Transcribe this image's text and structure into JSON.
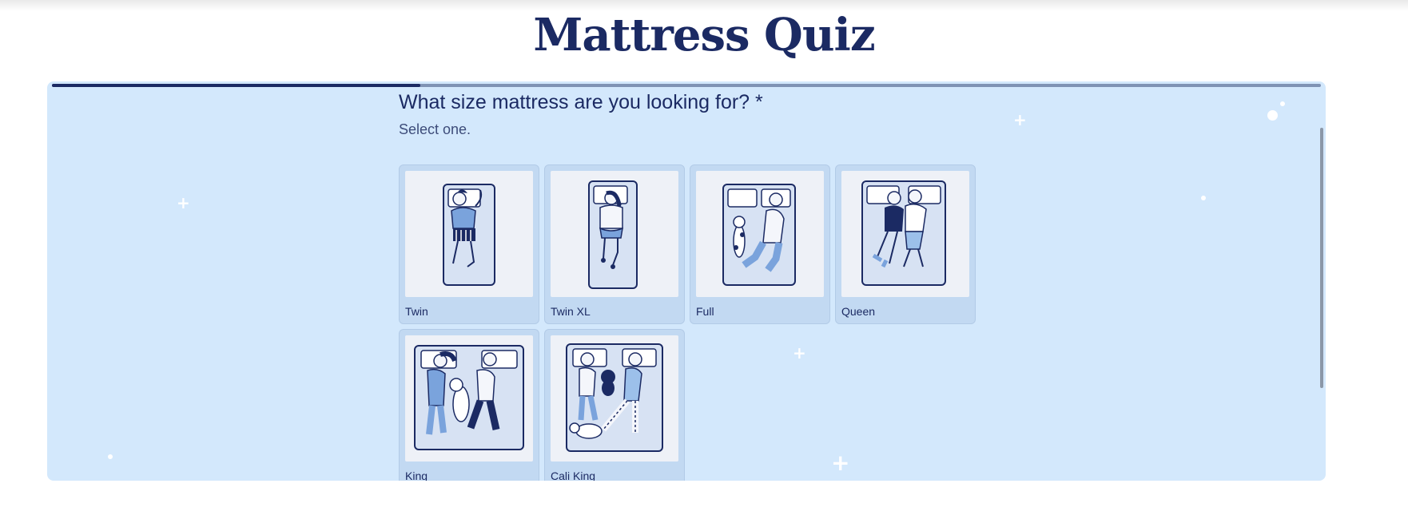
{
  "page": {
    "title": "Mattress Quiz"
  },
  "quiz": {
    "progress_fraction": 0.29,
    "question": "What size mattress are you looking for? *",
    "instruction": "Select one.",
    "options": [
      {
        "label": "Twin",
        "illustration": "one-sleeper-illustration"
      },
      {
        "label": "Twin XL",
        "illustration": "one-tall-sleeper-illustration"
      },
      {
        "label": "Full",
        "illustration": "sleeper-and-dog-illustration"
      },
      {
        "label": "Queen",
        "illustration": "couple-illustration"
      },
      {
        "label": "King",
        "illustration": "couple-and-dog-illustration"
      },
      {
        "label": "Cali King",
        "illustration": "couple-baby-and-cat-illustration"
      }
    ]
  },
  "colors": {
    "brand_navy": "#1b2a63",
    "panel_background": "#d3e8fc",
    "card_background": "#c2d9f2",
    "illustration_blue": "#7aa3dc"
  }
}
